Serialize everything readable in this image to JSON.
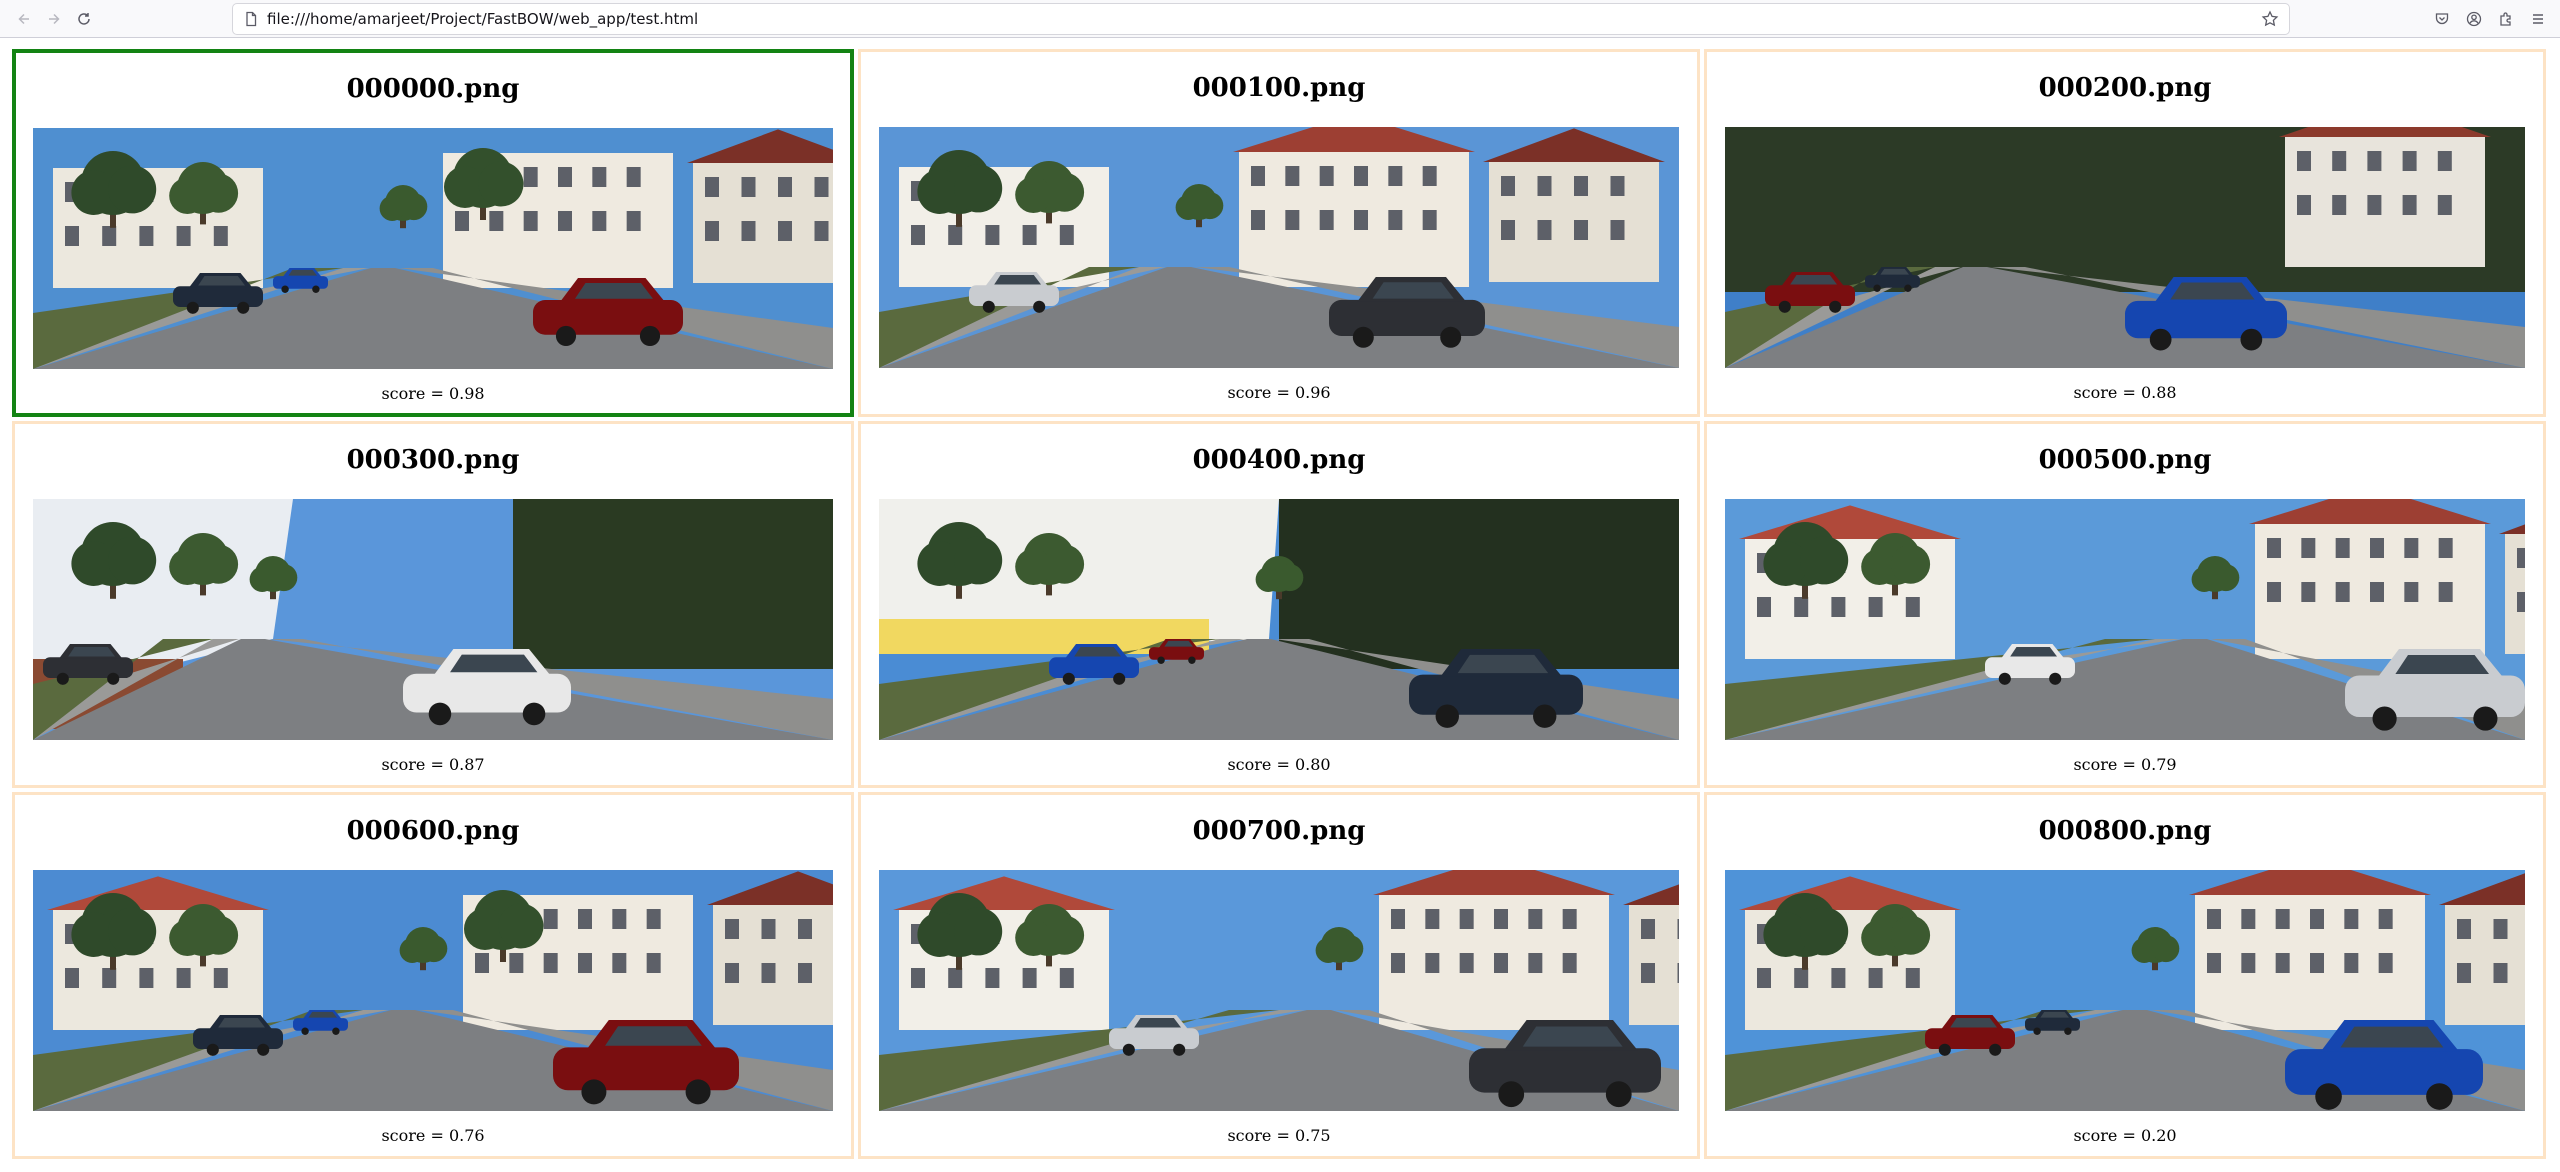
{
  "browser": {
    "url": "file:///home/amarjeet/Project/FastBOW/web_app/test.html",
    "icons": [
      "back-icon",
      "forward-icon",
      "reload-icon",
      "page-icon",
      "bookmark-star-icon",
      "pocket-icon",
      "account-icon",
      "extensions-icon",
      "menu-icon"
    ]
  },
  "results": [
    {
      "filename": "000000.png",
      "score": "score = 0.98",
      "selected": true
    },
    {
      "filename": "000100.png",
      "score": "score = 0.96"
    },
    {
      "filename": "000200.png",
      "score": "score = 0.88"
    },
    {
      "filename": "000300.png",
      "score": "score = 0.87"
    },
    {
      "filename": "000400.png",
      "score": "score = 0.80"
    },
    {
      "filename": "000500.png",
      "score": "score = 0.79"
    },
    {
      "filename": "000600.png",
      "score": "score = 0.76"
    },
    {
      "filename": "000700.png",
      "score": "score = 0.75"
    },
    {
      "filename": "000800.png",
      "score": "score = 0.20"
    }
  ],
  "colors": {
    "card_border": "#fde3c5",
    "selected_border": "#138313"
  }
}
